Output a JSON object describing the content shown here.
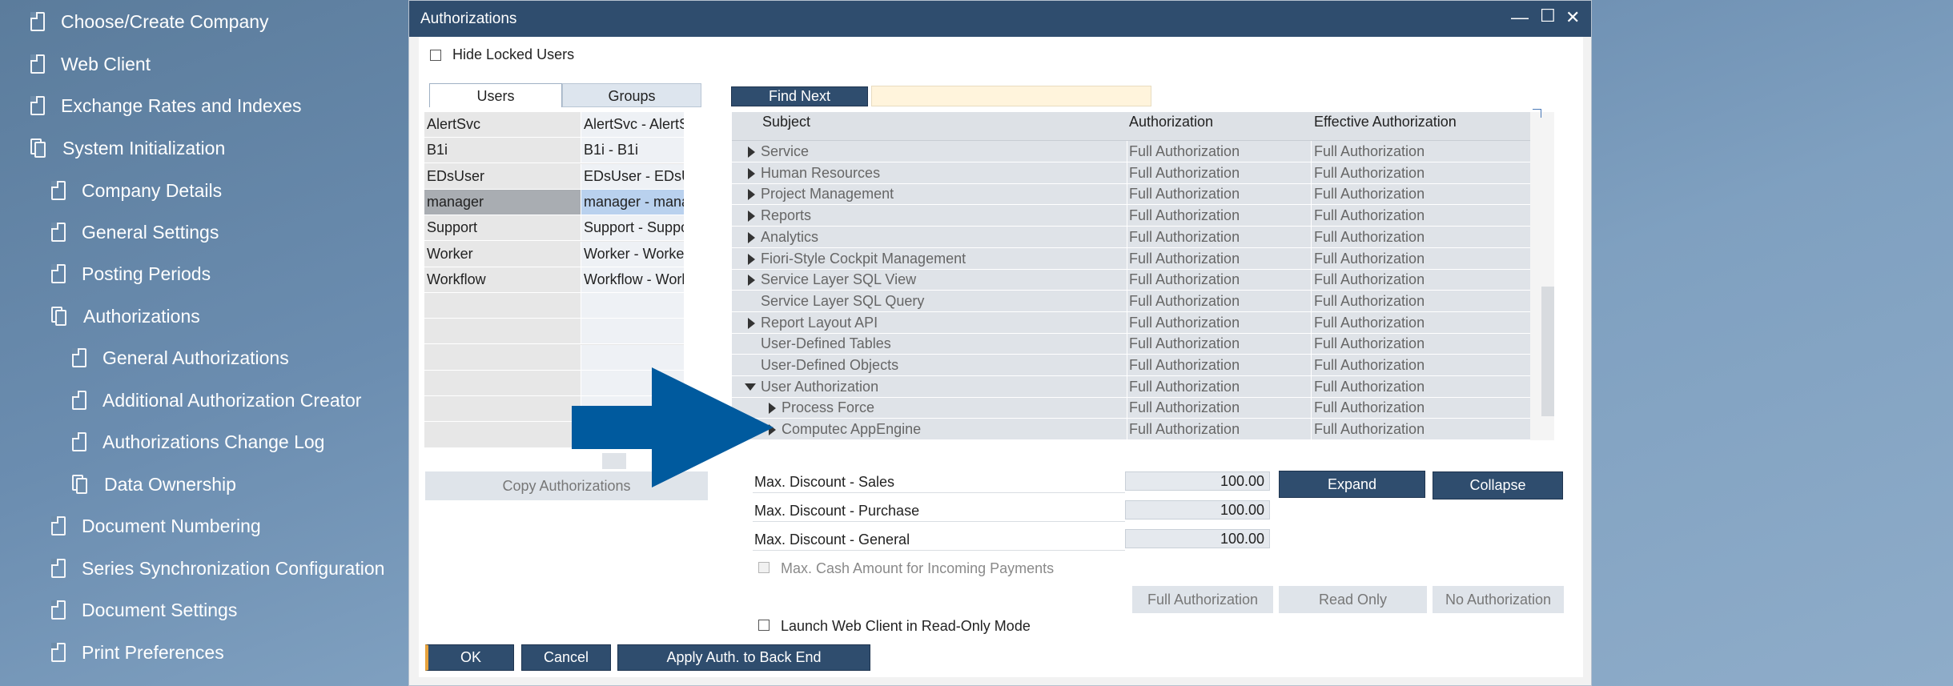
{
  "nav": {
    "items": [
      {
        "label": "Choose/Create Company",
        "icon": "document-icon"
      },
      {
        "label": "Web Client",
        "icon": "document-icon"
      },
      {
        "label": "Exchange Rates and Indexes",
        "icon": "document-icon"
      },
      {
        "label": "System Initialization",
        "icon": "folder-icon"
      },
      {
        "label": "Company Details",
        "icon": "document-icon"
      },
      {
        "label": "General Settings",
        "icon": "document-icon"
      },
      {
        "label": "Posting Periods",
        "icon": "document-icon"
      },
      {
        "label": "Authorizations",
        "icon": "folder-icon"
      },
      {
        "label": "General Authorizations",
        "icon": "document-icon"
      },
      {
        "label": "Additional Authorization Creator",
        "icon": "document-icon"
      },
      {
        "label": "Authorizations Change Log",
        "icon": "document-icon"
      },
      {
        "label": "Data Ownership",
        "icon": "folder-icon"
      },
      {
        "label": "Document Numbering",
        "icon": "document-icon"
      },
      {
        "label": "Series Synchronization Configuration",
        "icon": "document-icon"
      },
      {
        "label": "Document Settings",
        "icon": "document-icon"
      },
      {
        "label": "Print Preferences",
        "icon": "document-icon"
      }
    ]
  },
  "window": {
    "title": "Authorizations",
    "minimize_glyph": "—",
    "maximize_glyph": "☐",
    "close_glyph": "✕"
  },
  "hide_locked": {
    "label": "Hide Locked Users",
    "checked": false
  },
  "tabs": [
    {
      "label": "Users",
      "active": true
    },
    {
      "label": "Groups",
      "active": false
    }
  ],
  "users": [
    {
      "code": "AlertSvc",
      "name": "AlertSvc - AlertSvc"
    },
    {
      "code": "B1i",
      "name": "B1i - B1i"
    },
    {
      "code": "EDsUser",
      "name": "EDsUser - EDsUser"
    },
    {
      "code": "manager",
      "name": "manager - manager",
      "selected": true
    },
    {
      "code": "Support",
      "name": "Support - Support"
    },
    {
      "code": "Worker",
      "name": "Worker - Worker"
    },
    {
      "code": "Workflow",
      "name": "Workflow - Workflow"
    }
  ],
  "find": {
    "button_label": "Find Next",
    "value": ""
  },
  "auth_grid": {
    "headers": {
      "subject": "Subject",
      "authorization": "Authorization",
      "effective": "Effective Authorization"
    },
    "rows": [
      {
        "subject": "Service",
        "level": 0,
        "expander": "collapsed",
        "auth": "Full Authorization",
        "effective": "Full Authorization"
      },
      {
        "subject": "Human Resources",
        "level": 0,
        "expander": "collapsed",
        "auth": "Full Authorization",
        "effective": "Full Authorization"
      },
      {
        "subject": "Project Management",
        "level": 0,
        "expander": "collapsed",
        "auth": "Full Authorization",
        "effective": "Full Authorization"
      },
      {
        "subject": "Reports",
        "level": 0,
        "expander": "collapsed",
        "auth": "Full Authorization",
        "effective": "Full Authorization"
      },
      {
        "subject": "Analytics",
        "level": 0,
        "expander": "collapsed",
        "auth": "Full Authorization",
        "effective": "Full Authorization"
      },
      {
        "subject": "Fiori-Style Cockpit Management",
        "level": 0,
        "expander": "collapsed",
        "auth": "Full Authorization",
        "effective": "Full Authorization"
      },
      {
        "subject": "Service Layer SQL View",
        "level": 0,
        "expander": "collapsed",
        "auth": "Full Authorization",
        "effective": "Full Authorization"
      },
      {
        "subject": "Service Layer SQL Query",
        "level": 0,
        "expander": "none",
        "auth": "Full Authorization",
        "effective": "Full Authorization"
      },
      {
        "subject": "Report Layout API",
        "level": 0,
        "expander": "collapsed",
        "auth": "Full Authorization",
        "effective": "Full Authorization"
      },
      {
        "subject": "User-Defined Tables",
        "level": 0,
        "expander": "none",
        "auth": "Full Authorization",
        "effective": "Full Authorization"
      },
      {
        "subject": "User-Defined Objects",
        "level": 0,
        "expander": "none",
        "auth": "Full Authorization",
        "effective": "Full Authorization"
      },
      {
        "subject": "User Authorization",
        "level": 0,
        "expander": "expanded",
        "auth": "Full Authorization",
        "effective": "Full Authorization"
      },
      {
        "subject": "Process Force",
        "level": 1,
        "expander": "collapsed",
        "auth": "Full Authorization",
        "effective": "Full Authorization"
      },
      {
        "subject": "Computec AppEngine",
        "level": 1,
        "expander": "collapsed",
        "auth": "Full Authorization",
        "effective": "Full Authorization"
      }
    ]
  },
  "copy_button": "Copy Authorizations",
  "discounts": [
    {
      "label": "Max. Discount - Sales",
      "value": "100.00"
    },
    {
      "label": "Max. Discount - Purchase",
      "value": "100.00"
    },
    {
      "label": "Max. Discount - General",
      "value": "100.00"
    }
  ],
  "expand_button": "Expand",
  "collapse_button": "Collapse",
  "max_cash": {
    "label": "Max. Cash Amount for Incoming Payments",
    "checked": false,
    "disabled": true
  },
  "level_buttons": [
    "Full Authorization",
    "Read Only",
    "No Authorization"
  ],
  "web_client_ro": {
    "label": "Launch Web Client in Read-Only Mode",
    "checked": false
  },
  "footer": {
    "ok": "OK",
    "cancel": "Cancel",
    "apply": "Apply Auth. to Back End"
  },
  "colors": {
    "arrow": "#005a9e",
    "title_bar": "#2f4d6e",
    "button_dark": "#2f4d6e"
  }
}
